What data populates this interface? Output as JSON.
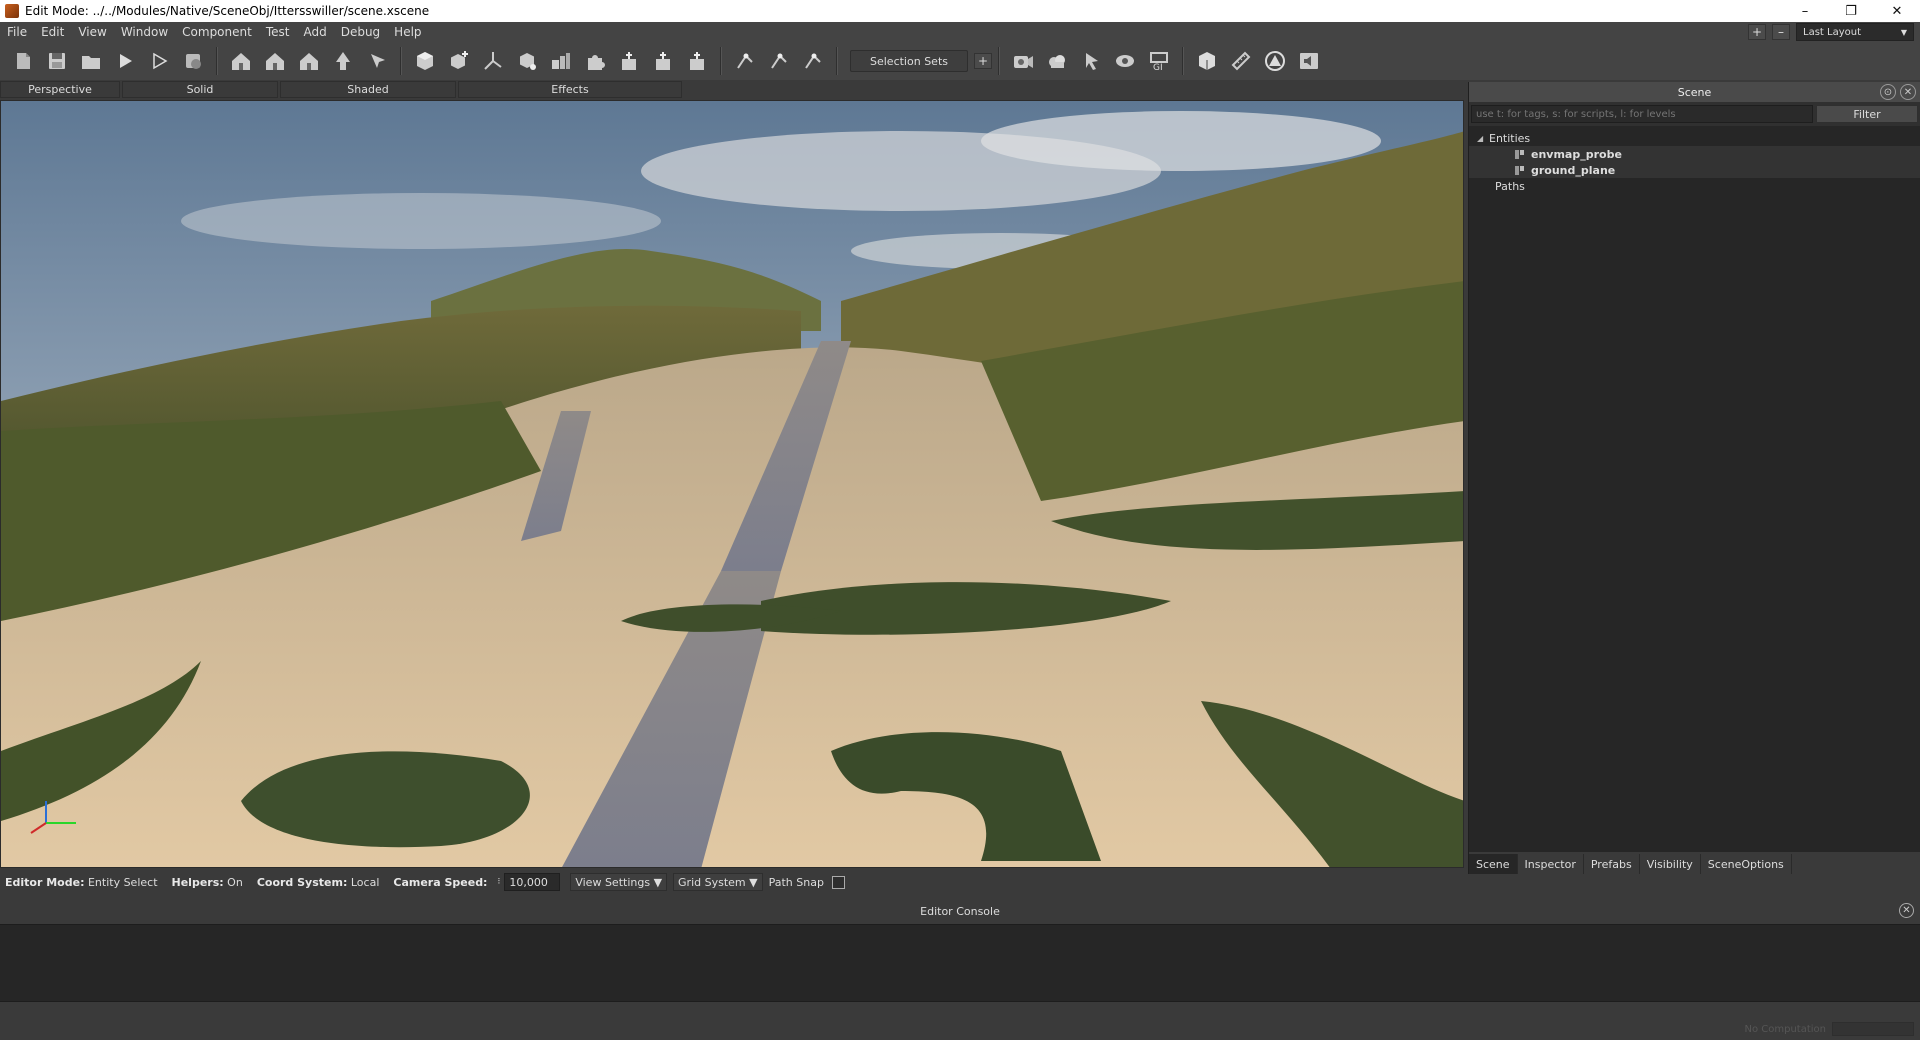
{
  "window": {
    "title": "Edit Mode: ../../Modules/Native/SceneObj/Ittersswiller/scene.xscene",
    "minimize": "–",
    "restore": "❐",
    "close": "✕"
  },
  "menu": [
    "File",
    "Edit",
    "View",
    "Window",
    "Component",
    "Test",
    "Add",
    "Debug",
    "Help"
  ],
  "layout": {
    "add": "+",
    "remove": "–",
    "selected": "Last Layout"
  },
  "toolbar": {
    "selection_sets": "Selection Sets",
    "selection_sets_add": "+",
    "groups": [
      [
        "new-scene-icon",
        "save-icon",
        "open-folder-icon",
        "play-icon",
        "play-outline-icon",
        "build-icon"
      ],
      [
        "house-icon",
        "house-icon",
        "house-icon",
        "arrow-up-icon",
        "pick-icon"
      ],
      [
        "cube-icon",
        "cube-plus-icon",
        "axes-icon",
        "cube-node-icon",
        "cubes-icon",
        "puzzle-icon",
        "gizmo-icon",
        "gizmo-icon",
        "gizmo-icon"
      ],
      [
        "snap-icon",
        "snap-icon",
        "snap-icon"
      ]
    ],
    "right_groups": [
      [
        "camera-settings-icon",
        "cloud-icon",
        "pointer-icon",
        "eye-icon",
        "gi-icon"
      ],
      [
        "render-icon",
        "measure-icon",
        "warning-icon",
        "sound-icon"
      ]
    ]
  },
  "viewport_tabs": [
    {
      "label": "Perspective",
      "w": 120
    },
    {
      "label": "Solid",
      "w": 156
    },
    {
      "label": "Shaded",
      "w": 176
    },
    {
      "label": "Effects",
      "w": 224
    }
  ],
  "scene_panel": {
    "title": "Scene",
    "filter_placeholder": "use t: for tags, s: for scripts, l: for levels",
    "filter_button": "Filter",
    "tree": {
      "entities_label": "Entities",
      "items": [
        "envmap_probe",
        "ground_plane"
      ],
      "paths_label": "Paths"
    },
    "tabs": [
      "Scene",
      "Inspector",
      "Prefabs",
      "Visibility",
      "SceneOptions"
    ],
    "active_tab": "Scene"
  },
  "status": {
    "editor_mode_label": "Editor Mode:",
    "editor_mode_value": "Entity Select",
    "helpers_label": "Helpers:",
    "helpers_value": "On",
    "coord_label": "Coord System:",
    "coord_value": "Local",
    "camera_speed_label": "Camera Speed:",
    "camera_speed_value": "10,000",
    "view_settings": "View Settings",
    "grid_system": "Grid System",
    "path_snap": "Path Snap",
    "path_snap_checked": false
  },
  "console": {
    "title": "Editor Console",
    "status": "No Computation"
  }
}
